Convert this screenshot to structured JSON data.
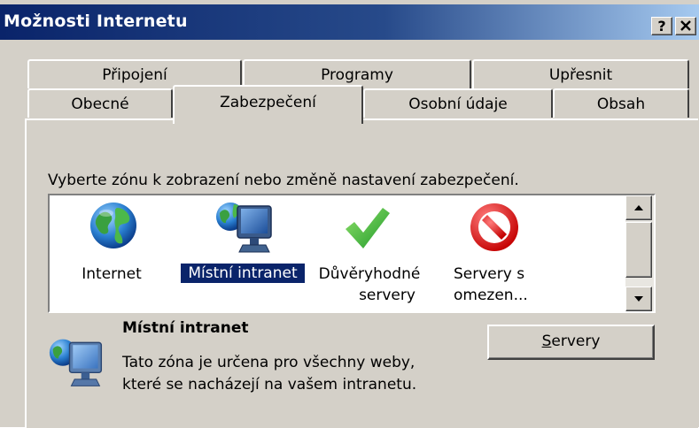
{
  "window": {
    "title": "Možnosti Internetu",
    "help_label": "?",
    "close_label": "✕"
  },
  "tabs": {
    "row_back": [
      "Připojení",
      "Programy",
      "Upřesnit"
    ],
    "row_front": [
      "Obecné",
      "Zabezpečení",
      "Osobní údaje",
      "Obsah"
    ],
    "active": "Zabezpečení"
  },
  "security": {
    "instruction": "Vyberte zónu k zobrazení nebo změně nastavení zabezpečení.",
    "zones": [
      {
        "label": "Internet",
        "icon": "globe-icon"
      },
      {
        "label": "Místní intranet",
        "icon": "intranet-monitor-icon",
        "selected": true
      },
      {
        "label": "Důvěryhodné servery",
        "line1": "Důvěryhodné",
        "line2": "servery",
        "icon": "checkmark-icon"
      },
      {
        "label": "Servery s omezen...",
        "line1": "Servery s",
        "line2": "omezen...",
        "icon": "restricted-icon"
      }
    ],
    "selected_zone": {
      "name": "Místní intranet",
      "description": "Tato zóna je určena pro všechny weby, které se nacházejí na vašem intranetu."
    },
    "servers_button": {
      "label": "Servery",
      "accelerator": "S",
      "rest": "ervery"
    }
  },
  "colors": {
    "title_bar_start": "#0a246a",
    "title_bar_end": "#a6caf0",
    "face": "#d4d0c8",
    "selection": "#0a246a"
  }
}
